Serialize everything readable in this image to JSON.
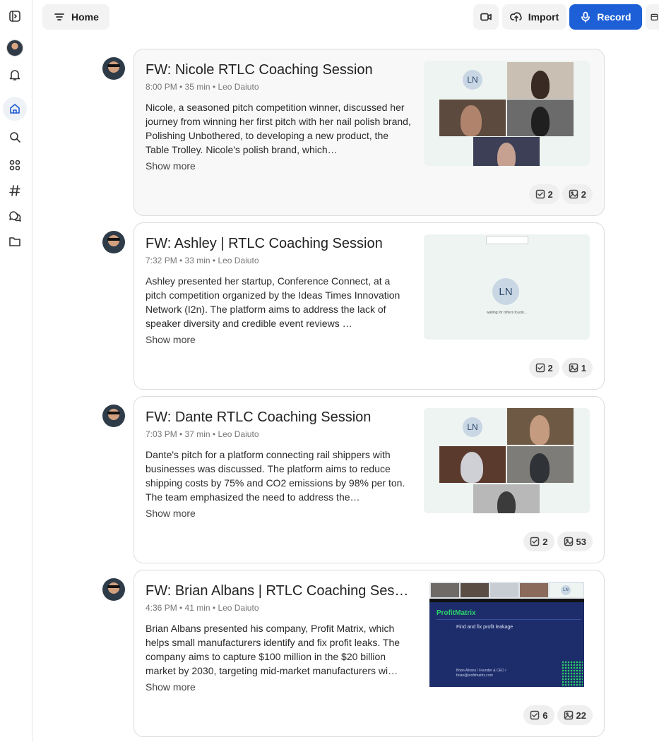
{
  "topbar": {
    "home_label": "Home",
    "import_label": "Import",
    "record_label": "Record"
  },
  "sidebar": {
    "items": [
      {
        "name": "toggle-sidebar"
      },
      {
        "name": "profile"
      },
      {
        "name": "notifications"
      },
      {
        "name": "home"
      },
      {
        "name": "search"
      },
      {
        "name": "apps"
      },
      {
        "name": "channels"
      },
      {
        "name": "chats"
      },
      {
        "name": "files"
      }
    ]
  },
  "meetings": [
    {
      "title": "FW: Nicole RTLC Coaching Session",
      "meta": "8:00 PM • 35 min • Leo Daiuto",
      "summary": "Nicole, a seasoned pitch competition winner, discussed her journey from winning her first pitch with her nail polish brand, Polishing Unbothered, to developing a new product, the Table Trolley. Nicole's polish brand, which…",
      "show_more": "Show more",
      "tasks": "2",
      "images": "2",
      "thumb_label": "LN"
    },
    {
      "title": "FW: Ashley | RTLC Coaching Session",
      "meta": "7:32 PM • 33 min • Leo Daiuto",
      "summary": "Ashley presented her startup, Conference Connect, at a pitch competition organized by the Ideas Times Innovation Network (I2n). The platform aims to address the lack of speaker diversity and credible event reviews …",
      "show_more": "Show more",
      "tasks": "2",
      "images": "1",
      "thumb_label": "LN",
      "thumb_caption": "waiting for others to join..."
    },
    {
      "title": "FW: Dante RTLC Coaching Session",
      "meta": "7:03 PM • 37 min • Leo Daiuto",
      "summary": "Dante's pitch for a platform connecting rail shippers with businesses was discussed. The platform aims to reduce shipping costs by 75% and CO2 emissions by 98% per ton. The team emphasized the need to address the…",
      "show_more": "Show more",
      "tasks": "2",
      "images": "53",
      "thumb_label": "LN"
    },
    {
      "title": "FW: Brian Albans | RTLC Coaching Ses…",
      "meta": "4:36 PM • 41 min • Leo Daiuto",
      "summary": "Brian Albans presented his company, Profit Matrix, which helps small manufacturers identify and fix profit leaks. The company aims to capture $100 million in the $20 billion market by 2030, targeting mid-market manufacturers wi…",
      "show_more": "Show more",
      "tasks": "6",
      "images": "22",
      "thumb_label": "LN",
      "slide_brand": "ProfitMatrix",
      "slide_heading": "Find and fix profit leakage",
      "slide_footer": "Brian Albans / Founder & CEO / brian@profitmatrix.com"
    }
  ],
  "colors": {
    "accent": "#1c5fd6",
    "thumb_bg": "#eef4f1",
    "slide_bg": "#1d2d6b",
    "slide_accent": "#2bd46a"
  }
}
